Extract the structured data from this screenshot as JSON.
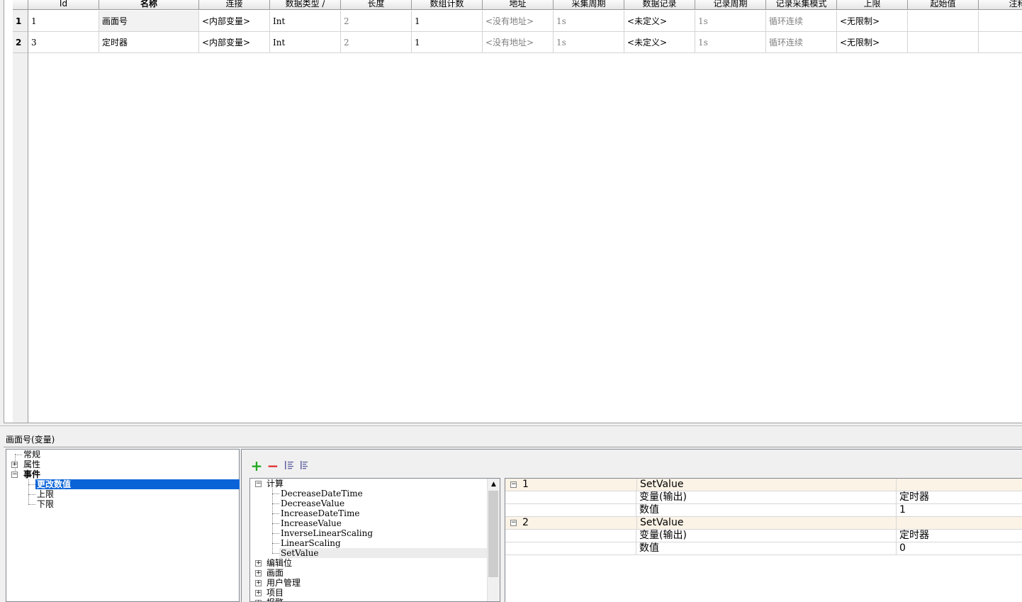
{
  "grid": {
    "columns": [
      {
        "label": "Id",
        "bold": false
      },
      {
        "label": "名称",
        "bold": true
      },
      {
        "label": "连接",
        "bold": false
      },
      {
        "label": "数据类型  ∕",
        "bold": false
      },
      {
        "label": "长度",
        "bold": false
      },
      {
        "label": "数组计数",
        "bold": false
      },
      {
        "label": "地址",
        "bold": false
      },
      {
        "label": "采集周期",
        "bold": false
      },
      {
        "label": "数据记录",
        "bold": false
      },
      {
        "label": "记录周期",
        "bold": false
      },
      {
        "label": "记录采集模式",
        "bold": false
      },
      {
        "label": "上限",
        "bold": false
      },
      {
        "label": "起始值",
        "bold": false
      },
      {
        "label": "注释",
        "bold": false
      }
    ],
    "rows": [
      {
        "num": "1",
        "cells": [
          "1",
          "画面号",
          "<内部变量>",
          "Int",
          "2",
          "1",
          "<没有地址>",
          "1s",
          "<未定义>",
          "1s",
          "循环连续",
          "<无限制>",
          "",
          ""
        ]
      },
      {
        "num": "2",
        "cells": [
          "3",
          "定时器",
          "<内部变量>",
          "Int",
          "2",
          "1",
          "<没有地址>",
          "1s",
          "<未定义>",
          "1s",
          "循环连续",
          "<无限制>",
          "",
          ""
        ]
      }
    ]
  },
  "panel_title": "画面号(变量)",
  "event_tree": {
    "items": [
      "常规",
      "属性",
      "事件",
      "更改数值",
      "上限",
      "下限"
    ]
  },
  "toolbar": {
    "add_icon": "add-icon",
    "remove_icon": "remove-icon",
    "indent_icon": "indent-icon",
    "outdent_icon": "outdent-icon",
    "add_color": "#22aa22",
    "remove_color": "#e03030"
  },
  "func_tree": {
    "category": "计算",
    "functions": [
      "DecreaseDateTime",
      "DecreaseValue",
      "IncreaseDateTime",
      "IncreaseValue",
      "InverseLinearScaling",
      "LinearScaling",
      "SetValue"
    ],
    "groups": [
      "编辑位",
      "画面",
      "用户管理",
      "项目",
      "报警"
    ]
  },
  "props": {
    "entries": [
      {
        "index": "1",
        "function": "SetValue",
        "params": [
          {
            "name": "变量(输出)",
            "value": "定时器"
          },
          {
            "name": "数值",
            "value": "1"
          }
        ]
      },
      {
        "index": "2",
        "function": "SetValue",
        "params": [
          {
            "name": "变量(输出)",
            "value": "定时器"
          },
          {
            "name": "数值",
            "value": "0"
          }
        ]
      }
    ]
  },
  "colors": {
    "selection": "#0a64d8",
    "header_row": "#fbf3e6"
  }
}
